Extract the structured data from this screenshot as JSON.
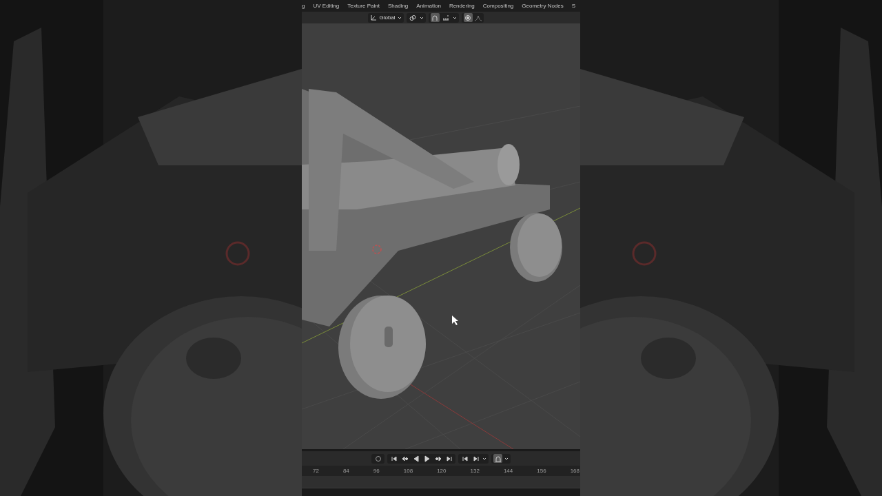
{
  "workspace_tabs": [
    {
      "label": "g"
    },
    {
      "label": "UV Editing"
    },
    {
      "label": "Texture Paint"
    },
    {
      "label": "Shading"
    },
    {
      "label": "Animation"
    },
    {
      "label": "Rendering"
    },
    {
      "label": "Compositing"
    },
    {
      "label": "Geometry Nodes"
    },
    {
      "label": "S"
    }
  ],
  "header": {
    "orientation": "Global",
    "snap_on": true,
    "proportional_on": true
  },
  "timeline": {
    "frame_ticks": [
      "72",
      "84",
      "96",
      "108",
      "120",
      "132",
      "144",
      "156",
      "168"
    ]
  }
}
